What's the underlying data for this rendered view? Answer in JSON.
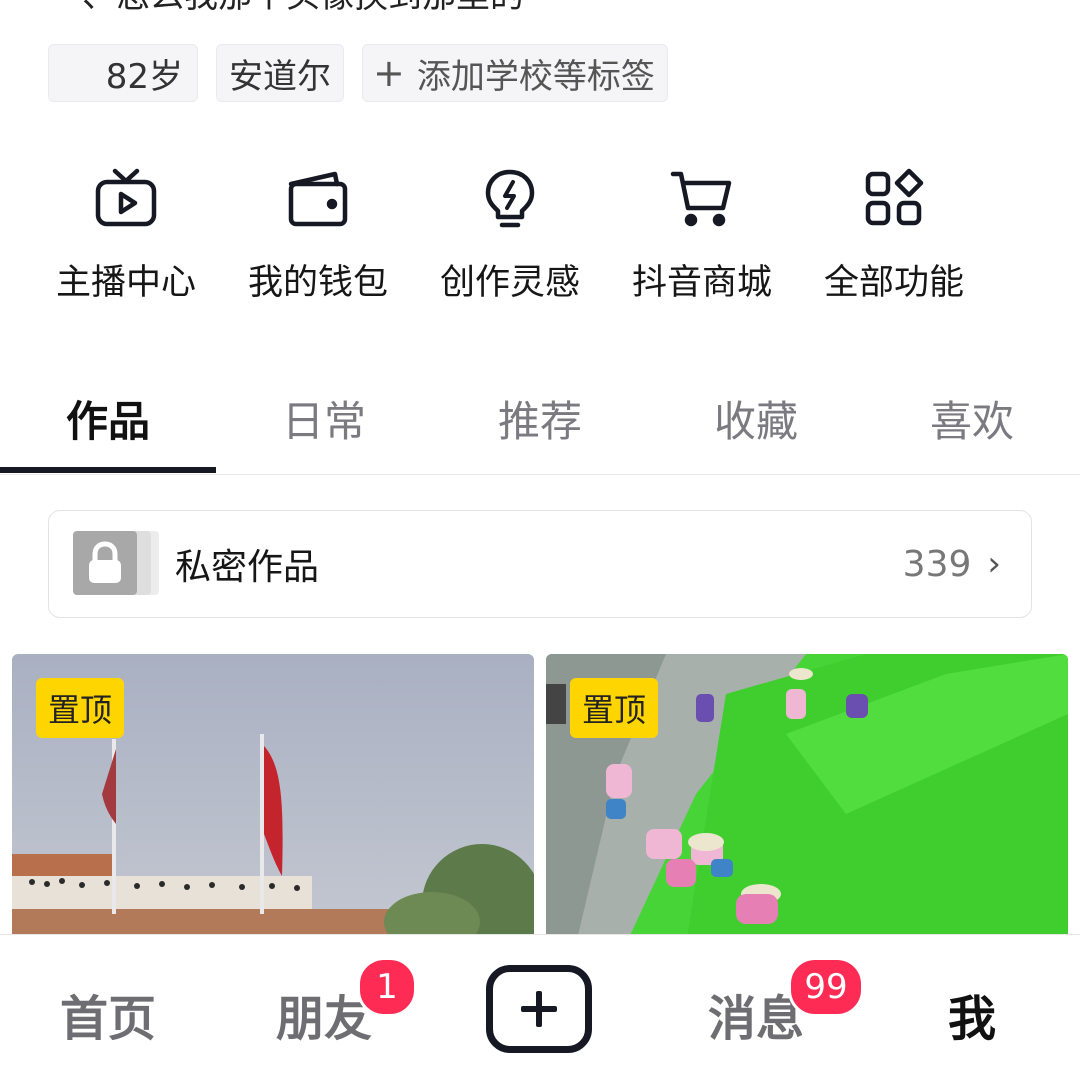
{
  "profile": {
    "bio_partial": "、怎么我那个头像换到那里的"
  },
  "tags": {
    "age": "82岁",
    "location": "安道尔",
    "add_label": "添加学校等标签"
  },
  "shortcuts": [
    {
      "label": "主播中心",
      "icon": "tv-play-icon"
    },
    {
      "label": "我的钱包",
      "icon": "wallet-icon"
    },
    {
      "label": "创作灵感",
      "icon": "lightbulb-icon"
    },
    {
      "label": "抖音商城",
      "icon": "cart-icon"
    },
    {
      "label": "全部功能",
      "icon": "grid-icon"
    }
  ],
  "tabs": [
    {
      "label": "作品",
      "active": true
    },
    {
      "label": "日常",
      "active": false
    },
    {
      "label": "推荐",
      "active": false
    },
    {
      "label": "收藏",
      "active": false
    },
    {
      "label": "喜欢",
      "active": false
    }
  ],
  "private_works": {
    "title": "私密作品",
    "count": "339"
  },
  "videos": [
    {
      "pinned_label": "置顶"
    },
    {
      "pinned_label": "置顶"
    }
  ],
  "bottom_nav": {
    "home": "首页",
    "friends": "朋友",
    "friends_badge": "1",
    "messages": "消息",
    "messages_badge": "99",
    "me": "我"
  },
  "colors": {
    "accent_red": "#fe2c55",
    "pin_yellow": "#ffd500",
    "dark": "#161823"
  }
}
